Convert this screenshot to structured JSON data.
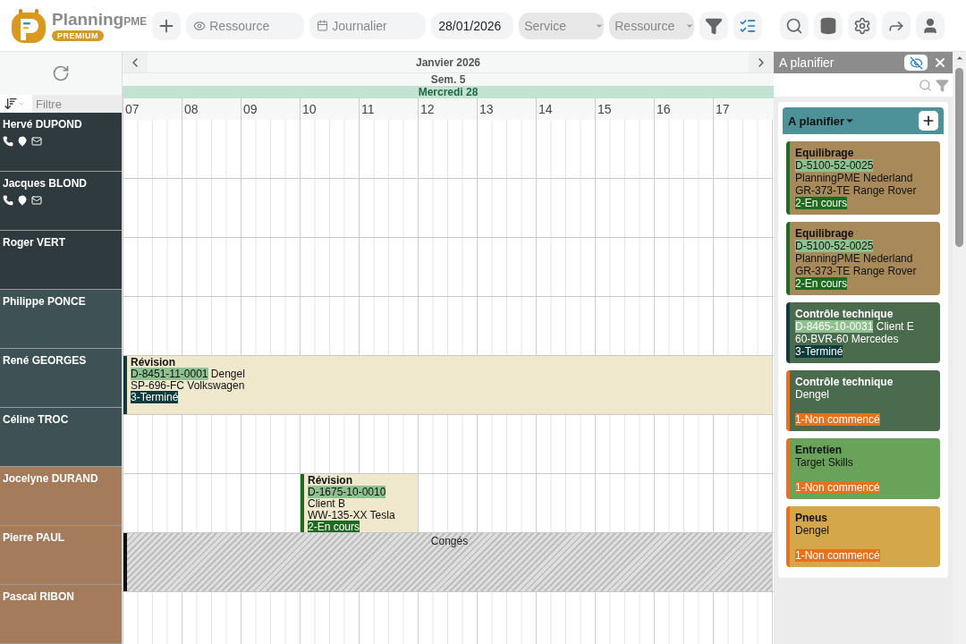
{
  "brand": {
    "name": "Planning",
    "suffix": "PME",
    "badge": "PREMIUM"
  },
  "toolbar": {
    "view": "Ressource",
    "period": "Journalier",
    "date": "28/01/2026",
    "service": "Service",
    "resource": "Ressource"
  },
  "sidebar": {
    "filter_placeholder": "Filtre"
  },
  "calendar": {
    "month": "Janvier 2026",
    "week": "Sem. 5",
    "day": "Mercredi 28",
    "hours": [
      "07",
      "08",
      "09",
      "10",
      "11",
      "12",
      "13",
      "14",
      "15",
      "16",
      "17"
    ]
  },
  "resources": [
    {
      "name": "Hervé DUPOND",
      "contacts": true,
      "color": "#2e3a3d"
    },
    {
      "name": "Jacques BLOND",
      "contacts": true,
      "color": "#2e3a3d"
    },
    {
      "name": "Roger VERT",
      "contacts": false,
      "color": "#2e3a3d"
    },
    {
      "name": "Philippe PONCE",
      "contacts": false,
      "color": "#3e5255"
    },
    {
      "name": "René GEORGES",
      "contacts": false,
      "color": "#3e5255",
      "events": [
        {
          "kind": "task",
          "full_day": true,
          "title": "Révision",
          "ref": "D-8451-11-0001",
          "client": "Dengel",
          "vehicle": "SP-696-FC Volkswagen",
          "status": {
            "label": "3-Terminé",
            "color": "#0f3b3d"
          }
        }
      ]
    },
    {
      "name": "Céline TROC",
      "contacts": false,
      "color": "#3e5255"
    },
    {
      "name": "Jocelyne DURAND",
      "contacts": false,
      "color": "#a47b5b",
      "events": [
        {
          "kind": "task",
          "full_day": false,
          "title": "Révision",
          "ref": "D-1675-10-0010",
          "client": "Client B",
          "vehicle": "WW-135-XX Tesla",
          "status": {
            "label": "2-En cours",
            "color": "#1e6a1e"
          }
        }
      ]
    },
    {
      "name": "Pierre PAUL",
      "contacts": false,
      "color": "#a47b5b",
      "events": [
        {
          "kind": "absence",
          "full_day": true,
          "title": "Congés"
        }
      ]
    },
    {
      "name": "Pascal RIBON",
      "contacts": false,
      "color": "#a47b5b"
    }
  ],
  "planner": {
    "title": "A planifier",
    "group": "A planifier",
    "cards": [
      {
        "title": "Equilibrage",
        "ref": "D-5100-52-0025",
        "client": "PlanningPME Nederland",
        "vehicle": "GR-373-TE Range Rover",
        "status": {
          "label": "2-En cours",
          "color": "#1e6a1e"
        },
        "color": "#a88a5a",
        "light_text": false
      },
      {
        "title": "Equilibrage",
        "ref": "D-5100-52-0025",
        "client": "PlanningPME Nederland",
        "vehicle": "GR-373-TE Range Rover",
        "status": {
          "label": "2-En cours",
          "color": "#1e6a1e"
        },
        "color": "#a88a5a",
        "light_text": false
      },
      {
        "title": "Contrôle technique",
        "ref": "D-8465-10-0031",
        "client": "Client E",
        "vehicle": "60-BVR-60 Mercedes",
        "status": {
          "label": "3-Terminé",
          "color": "#0f3b3d"
        },
        "color": "#4b6b4f",
        "light_text": true
      },
      {
        "title": "Contrôle technique",
        "client": "Dengel",
        "status": {
          "label": "1-Non commencé",
          "color": "#e8711b"
        },
        "color": "#4b6b4f",
        "light_text": true
      },
      {
        "title": "Entretien",
        "client": "Target Skills",
        "status": {
          "label": "1-Non commencé",
          "color": "#e8711b"
        },
        "color": "#69a35a",
        "light_text": false
      },
      {
        "title": "Pneus",
        "client": "Dengel",
        "status": {
          "label": "1-Non commencé",
          "color": "#e8711b"
        },
        "color": "#d4a84a",
        "light_text": false
      }
    ]
  }
}
